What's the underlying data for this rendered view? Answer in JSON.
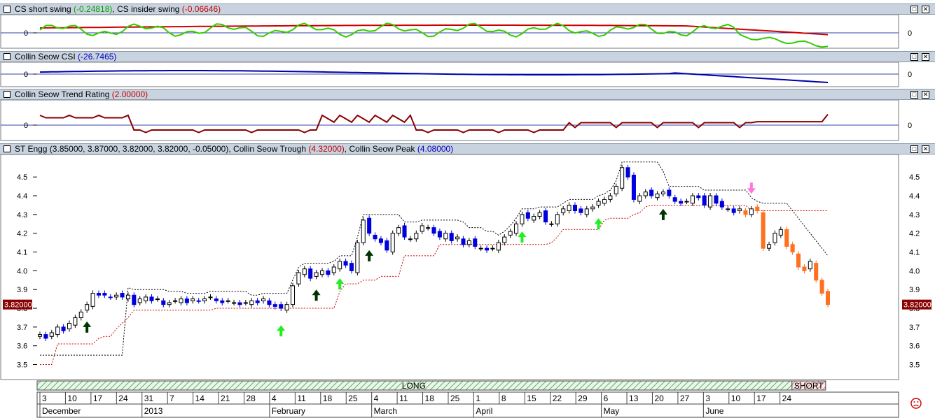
{
  "panels": [
    {
      "id": "swing",
      "title_parts": [
        {
          "text": "CS short swing ",
          "cls": ""
        },
        {
          "text": "(-0.24818)",
          "cls": "g"
        },
        {
          "text": ", CS insider swing ",
          "cls": ""
        },
        {
          "text": "(-0.06646)",
          "cls": "r"
        }
      ],
      "y_label": "0"
    },
    {
      "id": "csi",
      "title_parts": [
        {
          "text": "Collin Seow CSI ",
          "cls": ""
        },
        {
          "text": "(-26.7465)",
          "cls": "b"
        }
      ],
      "y_label": "0"
    },
    {
      "id": "trend",
      "title_parts": [
        {
          "text": "Collin Seow Trend Rating ",
          "cls": ""
        },
        {
          "text": "(2.00000)",
          "cls": "r"
        }
      ],
      "y_label": "0"
    },
    {
      "id": "price",
      "title_parts": [
        {
          "text": "ST Engg (3.85000, 3.87000, 3.82000, 3.82000, -0.05000), Collin Seow Trough ",
          "cls": ""
        },
        {
          "text": "(4.32000)",
          "cls": "r"
        },
        {
          "text": ", Collin Seow Peak ",
          "cls": ""
        },
        {
          "text": "(4.08000)",
          "cls": "b"
        }
      ],
      "y_label": ""
    }
  ],
  "colors": {
    "up_hollow": "#ffffff",
    "down_blue": "#0000dd",
    "down_orange": "#ff7020",
    "trough": "#cc0000",
    "peak": "#000000",
    "csi": "#0000aa",
    "insider": "#cc0000",
    "short": "#33cc00",
    "trend": "#880000",
    "arrow_up": "#22ee22",
    "arrow_dark": "#003300",
    "arrow_pink": "#ff77dd"
  },
  "last_price_label": "3.82000",
  "signal_bar": {
    "long_label": "LONG",
    "short_label": "SHORT"
  },
  "chart_data": {
    "type": "candlestick",
    "title": "ST Engg",
    "ylim": [
      3.42,
      4.62
    ],
    "y_ticks": [
      "3.5",
      "3.6",
      "3.7",
      "3.8",
      "3.9",
      "4.0",
      "4.1",
      "4.2",
      "4.3",
      "4.4",
      "4.5"
    ],
    "x_day_ticks": [
      "3",
      "10",
      "17",
      "24",
      "31",
      "7",
      "14",
      "21",
      "28",
      "4",
      "11",
      "18",
      "25",
      "4",
      "11",
      "18",
      "25",
      "1",
      "8",
      "15",
      "22",
      "29",
      "6",
      "13",
      "20",
      "27",
      "3",
      "10",
      "17",
      "24"
    ],
    "x_month_labels": [
      "December",
      "2013",
      "February",
      "March",
      "April",
      "May",
      "June"
    ],
    "close_series": [
      3.66,
      3.64,
      3.67,
      3.7,
      3.68,
      3.72,
      3.75,
      3.78,
      3.82,
      3.88,
      3.87,
      3.87,
      3.86,
      3.87,
      3.86,
      3.87,
      3.82,
      3.85,
      3.86,
      3.84,
      3.85,
      3.82,
      3.83,
      3.84,
      3.85,
      3.83,
      3.85,
      3.84,
      3.85,
      3.86,
      3.84,
      3.83,
      3.84,
      3.83,
      3.82,
      3.83,
      3.84,
      3.83,
      3.85,
      3.82,
      3.81,
      3.8,
      3.82,
      3.92,
      3.99,
      4.01,
      3.96,
      3.99,
      4.0,
      3.98,
      4.02,
      4.05,
      4.03,
      4.0,
      4.15,
      4.27,
      4.2,
      4.17,
      4.15,
      4.11,
      4.2,
      4.23,
      4.18,
      4.17,
      4.2,
      4.24,
      4.23,
      4.2,
      4.18,
      4.2,
      4.16,
      4.18,
      4.14,
      4.16,
      4.13,
      4.12,
      4.11,
      4.12,
      4.15,
      4.18,
      4.21,
      4.25,
      4.3,
      4.28,
      4.29,
      4.31,
      4.26,
      4.25,
      4.3,
      4.33,
      4.35,
      4.32,
      4.31,
      4.33,
      4.34,
      4.37,
      4.38,
      4.4,
      4.45,
      4.55,
      4.5,
      4.38,
      4.4,
      4.42,
      4.4,
      4.41,
      4.42,
      4.4,
      4.37,
      4.36,
      4.37,
      4.4,
      4.39,
      4.35,
      4.4,
      4.36,
      4.34,
      4.33,
      4.31,
      4.33,
      4.3,
      4.33,
      4.32,
      4.12,
      4.14,
      4.2,
      4.22,
      4.13,
      4.1,
      4.02,
      4.0,
      4.05,
      3.95,
      3.88,
      3.82
    ],
    "trough_series_range": [
      3.5,
      4.32
    ],
    "peak_series_range": [
      3.55,
      4.08
    ],
    "indicators": {
      "short_swing": -0.24818,
      "insider_swing": -0.06646,
      "csi": -26.7465,
      "trend_rating": 2.0
    }
  }
}
